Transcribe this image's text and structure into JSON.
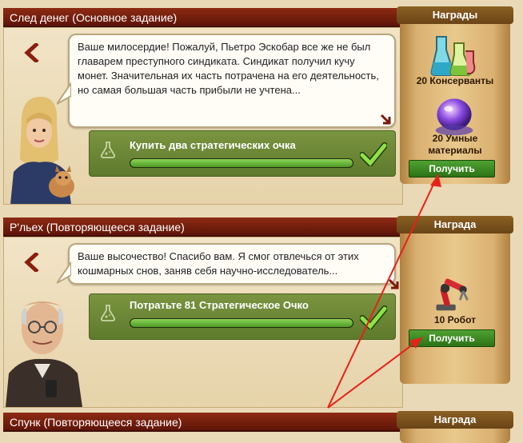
{
  "quests": [
    {
      "title": "След денег (Основное задание)",
      "dialog": "Ваше милосердие! Пожалуй, Пьетро Эскобар все же не был главарем преступного синдиката. Синдикат получил кучу монет. Значительная их часть потрачена на его деятельность, но самая большая часть прибыли не учтена...",
      "task": {
        "label": "Купить два стратегических очка",
        "progress": 1.0
      },
      "rewards_header": "Награды",
      "rewards": [
        {
          "label": "20 Консерванты",
          "icon": "flasks-icon"
        },
        {
          "label": "20 Умные материалы",
          "icon": "crystal-orb-icon"
        }
      ],
      "claim_label": "Получить"
    },
    {
      "title": "Р'льех (Повторяющееся задание)",
      "dialog": "Ваше высочество! Спасибо вам. Я смог отвлечься от этих кошмарных снов, заняв себя научно-исследователь...",
      "task": {
        "label": "Потратьте 81 Стратегическое Очко",
        "progress": 1.0
      },
      "rewards_header": "Награда",
      "rewards": [
        {
          "label": "10 Робот",
          "icon": "robot-arm-icon"
        }
      ],
      "claim_label": "Получить"
    },
    {
      "title": "Спунк (Повторяющееся задание)",
      "rewards_header": "Награда"
    }
  ],
  "colors": {
    "title_bar": "#6f1c0c",
    "task_green": "#6b8736",
    "claim_green": "#3d8a22",
    "annotation_red": "#e8201a"
  }
}
